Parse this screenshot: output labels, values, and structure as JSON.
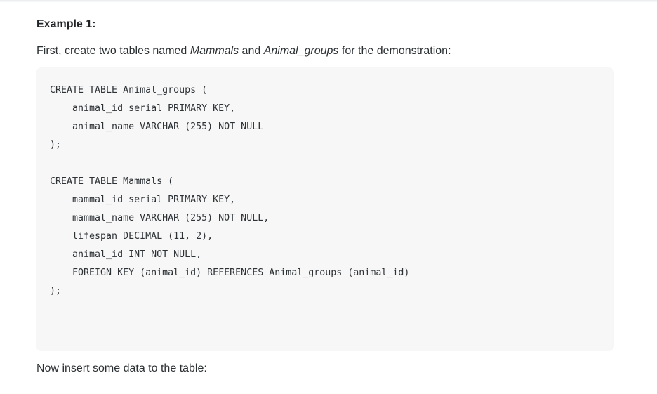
{
  "heading": "Example 1:",
  "intro": {
    "before": "First, create two tables named ",
    "table1": "Mammals",
    "between": " and ",
    "table2": "Animal_groups",
    "after": " for the demonstration:"
  },
  "code": {
    "lines": [
      "CREATE TABLE Animal_groups (",
      "    animal_id serial PRIMARY KEY,",
      "    animal_name VARCHAR (255) NOT NULL",
      ");",
      "",
      "CREATE TABLE Mammals (",
      "    mammal_id serial PRIMARY KEY,",
      "    mammal_name VARCHAR (255) NOT NULL,",
      "    lifespan DECIMAL (11, 2),",
      "    animal_id INT NOT NULL,",
      "    FOREIGN KEY (animal_id) REFERENCES Animal_groups (animal_id)",
      ");"
    ]
  },
  "outro": "Now insert some data to the table:"
}
